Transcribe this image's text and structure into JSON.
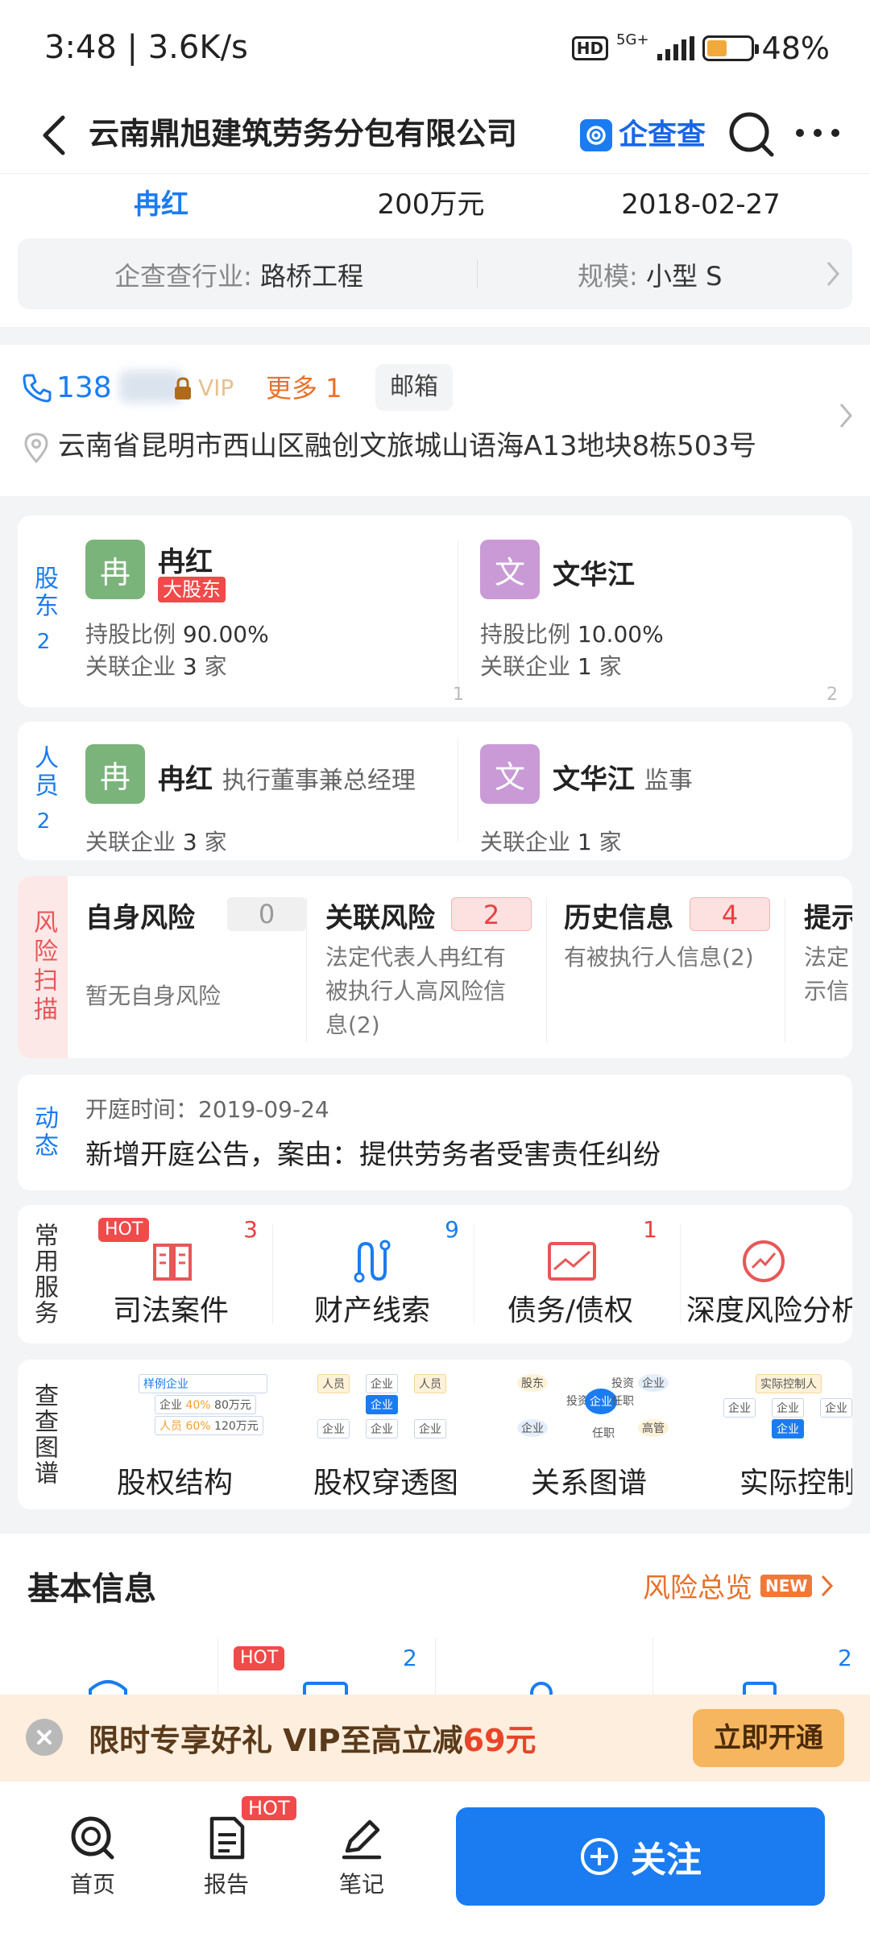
{
  "status_bar": {
    "time": "3:48 | 3.6K/s",
    "network": "5G+",
    "hd": "HD",
    "battery": "48%"
  },
  "header": {
    "title": "云南鼎旭建筑劳务分包有限公司",
    "brand": "企查查"
  },
  "summary": {
    "legal_rep": "冉红",
    "capital": "200万元",
    "date": "2018-02-27",
    "industry_label": "企查查行业: ",
    "industry_value": "路桥工程",
    "scale_label": "规模: ",
    "scale_value": "小型 S"
  },
  "contact": {
    "phone": "138",
    "vip_tag": "VIP",
    "more": "更多 1",
    "email": "邮箱",
    "address": "云南省昆明市西山区融创文旅城山语海A13地块8栋503号"
  },
  "shareholders": {
    "label": "股东",
    "count": "2",
    "items": [
      {
        "avatar": "冉",
        "name": "冉红",
        "badge": "大股东",
        "ratio_label": "持股比例",
        "ratio": "90.00%",
        "assoc_label": "关联企业",
        "assoc": "3",
        "assoc_unit": "家",
        "index": "1"
      },
      {
        "avatar": "文",
        "name": "文华江",
        "ratio_label": "持股比例",
        "ratio": "10.00%",
        "assoc_label": "关联企业",
        "assoc": "1",
        "assoc_unit": "家",
        "index": "2"
      }
    ]
  },
  "personnel": {
    "label": "人员",
    "count": "2",
    "items": [
      {
        "avatar": "冉",
        "name": "冉红",
        "role": "执行董事兼总经理",
        "assoc_label": "关联企业",
        "assoc": "3",
        "assoc_unit": "家"
      },
      {
        "avatar": "文",
        "name": "文华江",
        "role": "监事",
        "assoc_label": "关联企业",
        "assoc": "1",
        "assoc_unit": "家"
      }
    ]
  },
  "risk": {
    "label": "风险扫描",
    "items": [
      {
        "title": "自身风险",
        "count": "0",
        "desc": "暂无自身风险"
      },
      {
        "title": "关联风险",
        "count": "2",
        "desc": "法定代表人冉红有被执行人高风险信息(2)"
      },
      {
        "title": "历史信息",
        "count": "4",
        "desc": "有被执行人信息(2)"
      },
      {
        "title": "提示",
        "desc": "法定示信"
      }
    ]
  },
  "news": {
    "label": "动态",
    "time": "开庭时间：2019-09-24",
    "text": "新增开庭公告，案由：提供劳务者受害责任纠纷"
  },
  "services": {
    "label": "常用服务",
    "items": [
      {
        "label": "司法案件",
        "count": "3",
        "hot": "HOT"
      },
      {
        "label": "财产线索",
        "count": "9"
      },
      {
        "label": "债务/债权",
        "count": "1"
      },
      {
        "label": "深度风险分析"
      }
    ]
  },
  "graphs": {
    "label": "查查图谱",
    "items": [
      {
        "label": "股权结构",
        "mini": [
          "样例企业",
          "企业",
          "40%",
          "80万元",
          "人员",
          "60%",
          "120万元"
        ]
      },
      {
        "label": "股权穿透图",
        "mini": [
          "人员",
          "企业",
          "人员",
          "企业",
          "企业",
          "企业",
          "企业"
        ]
      },
      {
        "label": "关系图谱",
        "mini": [
          "股东",
          "投资",
          "企业",
          "投资",
          "企业",
          "企业",
          "任职",
          "高管",
          "企业",
          "任职",
          "投资",
          "任职"
        ]
      },
      {
        "label": "实际控制人",
        "mini": [
          "实际控制人",
          "企业",
          "企业",
          "企业",
          "企业"
        ]
      }
    ]
  },
  "basic_info": {
    "title": "基本信息",
    "risk_overview": "风险总览",
    "new_badge": "NEW",
    "hot": "HOT",
    "count_2": "2",
    "count_4": "2"
  },
  "promo": {
    "text_1": "限时专享好礼  VIP至高立减",
    "amount": "69元",
    "button": "立即开通"
  },
  "bottom_nav": {
    "home": "首页",
    "report": "报告",
    "report_badge": "HOT",
    "notes": "笔记",
    "follow": "关注"
  }
}
